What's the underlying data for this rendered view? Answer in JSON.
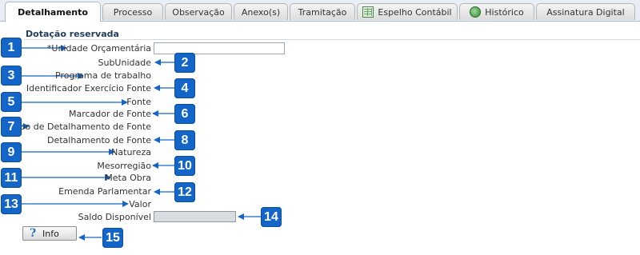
{
  "tabs": [
    {
      "label": "Detalhamento",
      "active": true
    },
    {
      "label": "Processo"
    },
    {
      "label": "Observação"
    },
    {
      "label": "Anexo(s)"
    },
    {
      "label": "Tramitação"
    },
    {
      "label": "Espelho Contábil",
      "icon": "spreadsheet-icon"
    },
    {
      "label": "Histórico",
      "icon": "history-icon"
    },
    {
      "label": "Assinatura Digital"
    }
  ],
  "section": {
    "title": "Dotação reservada"
  },
  "fields": {
    "unidade_orcamentaria": {
      "label": "Unidade Orçamentária",
      "required_marker": "*",
      "value": ""
    },
    "subunidade": {
      "label": "SubUnidade"
    },
    "programa_trabalho": {
      "label": "Programa de trabalho"
    },
    "identificador_exercicio_fonte": {
      "label": "Identificador Exercício Fonte"
    },
    "fonte": {
      "label": "Fonte"
    },
    "marcador_fonte": {
      "label": "Marcador de Fonte"
    },
    "tipo_detalhamento_fonte": {
      "label": "Tipo de Detalhamento de Fonte"
    },
    "detalhamento_fonte": {
      "label": "Detalhamento de Fonte"
    },
    "natureza": {
      "label": "Natureza"
    },
    "mesorregiao": {
      "label": "Mesorregião"
    },
    "meta_obra": {
      "label": "Meta Obra"
    },
    "emenda_parlamentar": {
      "label": "Emenda Parlamentar"
    },
    "valor": {
      "label": "Valor"
    },
    "saldo_disponivel": {
      "label": "Saldo Disponível",
      "value": ""
    }
  },
  "info_button": {
    "label": "Info",
    "icon": "question-icon"
  },
  "callouts": [
    "1",
    "2",
    "3",
    "4",
    "5",
    "6",
    "7",
    "8",
    "9",
    "10",
    "11",
    "12",
    "13",
    "14",
    "15"
  ],
  "colors": {
    "badge": "#1465c8",
    "arrow": "#1465c8",
    "section_title": "#1f3c5c"
  }
}
